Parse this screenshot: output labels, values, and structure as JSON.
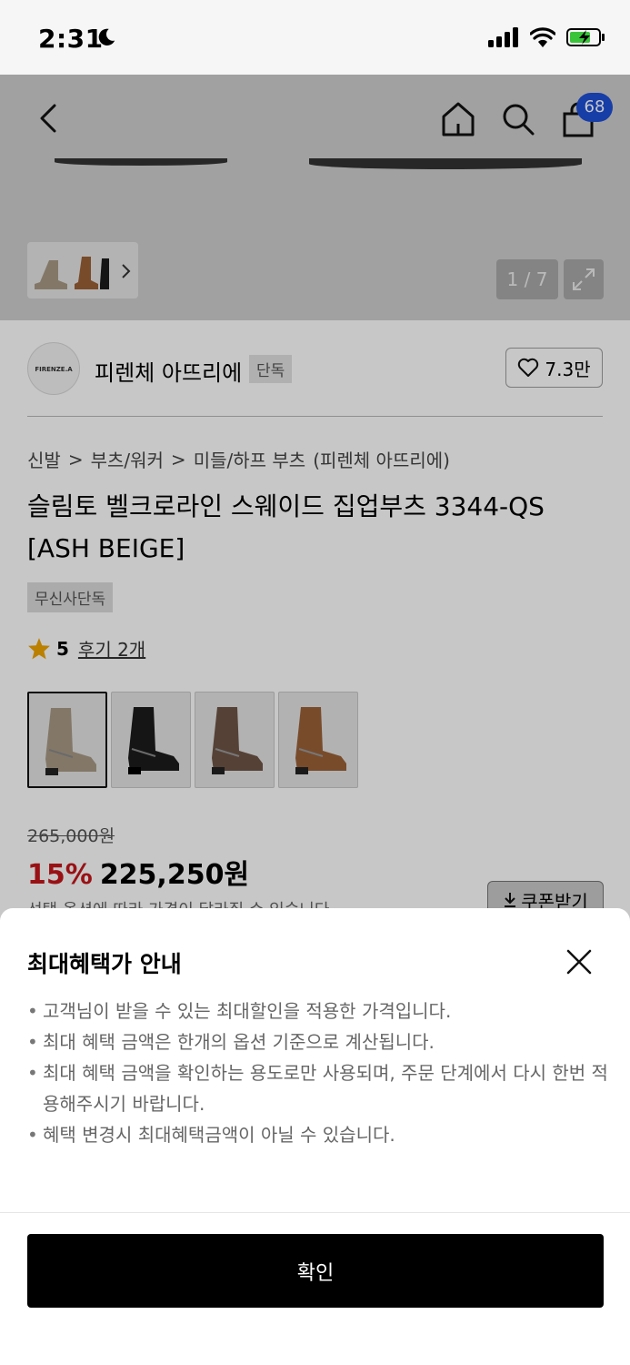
{
  "status_bar": {
    "time": "2:31"
  },
  "header": {
    "cart_count": "68"
  },
  "gallery": {
    "counter": "1 / 7"
  },
  "brand": {
    "logo_text": "FIRENZE.A",
    "name": "피렌체 아뜨리에",
    "tag": "단독",
    "likes": "7.3만"
  },
  "breadcrumb": [
    "신발",
    "부츠/워커",
    "미들/하프 부츠",
    "(피렌체 아뜨리에)"
  ],
  "product": {
    "title": "슬림토 벨크로라인 스웨이드 집업부츠 3344-QS [ASH BEIGE]",
    "exclusive_tag": "무신사단독",
    "rating": "5",
    "reviews": "후기 2개",
    "original_price": "265,000원",
    "discount": "15%",
    "sale_price": "225,250원",
    "coupon_label": "쿠폰받기",
    "price_note": "선택 옵션에 따라 가격이 달라질 수 있습니다"
  },
  "variants": [
    {
      "name": "ash-beige",
      "color": "#a89a86"
    },
    {
      "name": "black",
      "color": "#1b1b1b"
    },
    {
      "name": "brown",
      "color": "#6e5446"
    },
    {
      "name": "tan",
      "color": "#9a6038"
    }
  ],
  "sheet": {
    "title": "최대혜택가 안내",
    "items": [
      "고객님이 받을 수 있는 최대할인을 적용한 가격입니다.",
      "최대 혜택 금액은 한개의 옵션 기준으로 계산됩니다.",
      "최대 혜택 금액을 확인하는 용도로만 사용되며, 주문 단계에서 다시 한번 적용해주시기 바랍니다.",
      "혜택 변경시 최대혜택금액이 아닐 수 있습니다."
    ],
    "confirm_label": "확인"
  },
  "colors": {
    "accent_red": "#c4161c",
    "badge_blue": "#1e4fd6",
    "star": "#f0a400"
  }
}
